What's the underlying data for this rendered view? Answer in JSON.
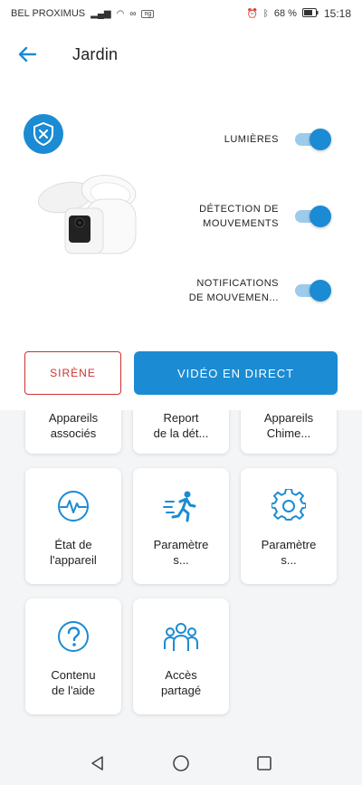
{
  "status_bar": {
    "carrier": "BEL PROXIMUS",
    "battery": "68 %",
    "time": "15:18",
    "badge": "ng"
  },
  "header": {
    "title": "Jardin"
  },
  "toggles": [
    {
      "label": "LUMIÈRES",
      "on": true
    },
    {
      "label": "DÉTECTION DE\nMOUVEMENTS",
      "on": true
    },
    {
      "label": "NOTIFICATIONS\nDE MOUVEMEN...",
      "on": true
    }
  ],
  "actions": {
    "siren_label": "SIRÈNE",
    "live_label": "VIDÉO EN DIRECT"
  },
  "tiles": [
    {
      "label": "Appareils\nassociés",
      "icon": "linked-devices-icon"
    },
    {
      "label": "Report\nde la dét...",
      "icon": "report-icon"
    },
    {
      "label": "Appareils\nChime...",
      "icon": "chime-icon"
    },
    {
      "label": "État de\nl'appareil",
      "icon": "device-health-icon"
    },
    {
      "label": "Paramètre\ns...",
      "icon": "motion-settings-icon"
    },
    {
      "label": "Paramètre\ns...",
      "icon": "gear-icon"
    },
    {
      "label": "Contenu\nde l'aide",
      "icon": "help-icon"
    },
    {
      "label": "Accès\npartagé",
      "icon": "shared-users-icon"
    }
  ],
  "colors": {
    "accent": "#1b8bd3",
    "siren": "#c8332f",
    "toggle_track": "#9ccbeb"
  }
}
